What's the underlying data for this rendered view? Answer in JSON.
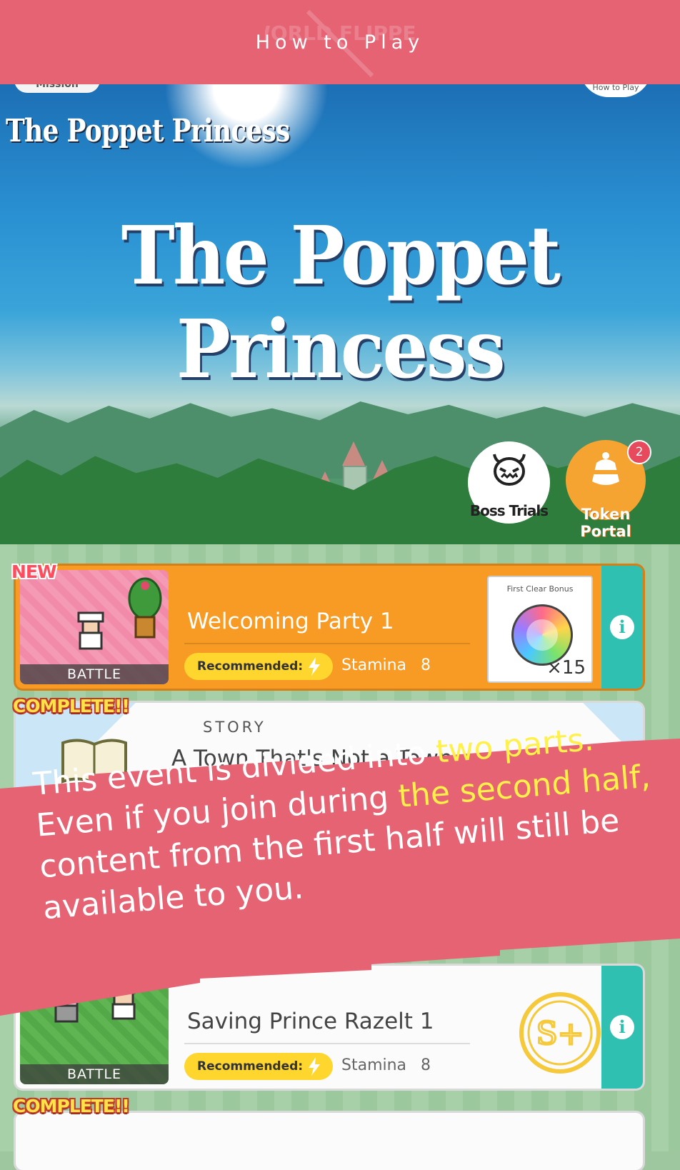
{
  "header": {
    "title": "How to Play",
    "logo_text": "WORLD FLIPPER"
  },
  "scene": {
    "mission_label": "Mission",
    "howto_label": "How to Play",
    "event_logo_small": "The Poppet Princess",
    "event_logo_big": "The Poppet Princess",
    "boss_trials_label": "Boss Trials",
    "token_portal_label": "Token Portal",
    "token_badge_count": "2"
  },
  "quests": [
    {
      "ribbon": "NEW",
      "type": "BATTLE",
      "title": "Welcoming Party 1",
      "recommended_label": "Recommended:",
      "stamina_label": "Stamina",
      "stamina_value": "8",
      "bonus_label": "First Clear Bonus",
      "bonus_qty": "×15"
    },
    {
      "ribbon": "COMPLETE!!",
      "type": "STORY",
      "title": "A Town That's Not a Town"
    },
    {
      "type": "BATTLE",
      "title": "Saving Prince Razelt 1",
      "recommended_label": "Recommended:",
      "stamina_label": "Stamina",
      "stamina_value": "8",
      "rank": "S+"
    },
    {
      "ribbon": "COMPLETE!!"
    }
  ],
  "banner": {
    "line1_pre": "This event is divided ",
    "line1_mid": "into ",
    "line1_hl": "two parts.",
    "line2_pre": "Even if you join during ",
    "line2_hl": "the second half,",
    "line3": "content from the first half will still be",
    "line4": "available to you."
  },
  "colors": {
    "header_bg": "#e66374",
    "highlight": "#fff04a",
    "quest_orange": "#f79b24",
    "info_teal": "#2fc0b1"
  }
}
